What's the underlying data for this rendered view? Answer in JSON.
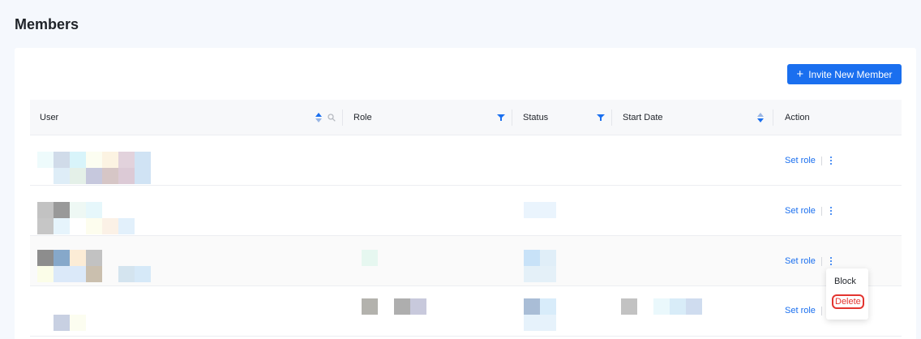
{
  "page": {
    "title": "Members"
  },
  "toolbar": {
    "invite_label": "Invite New Member"
  },
  "table": {
    "columns": [
      {
        "key": "user",
        "label": "User"
      },
      {
        "key": "role",
        "label": "Role"
      },
      {
        "key": "status",
        "label": "Status"
      },
      {
        "key": "start_date",
        "label": "Start Date"
      },
      {
        "key": "action",
        "label": "Action"
      }
    ],
    "rows": [
      {
        "action": "Set role"
      },
      {
        "action": "Set role"
      },
      {
        "action": "Set role"
      },
      {
        "action": "Set role"
      }
    ]
  },
  "menu": {
    "items": [
      "Block",
      "Delete"
    ]
  },
  "colors": {
    "accent": "#1a6fef",
    "danger": "#e3342f"
  },
  "icons": {
    "sort": "sort-icon",
    "filter": "filter-icon",
    "search": "search-icon",
    "more": "more-vertical-icon",
    "plus": "plus-icon"
  }
}
